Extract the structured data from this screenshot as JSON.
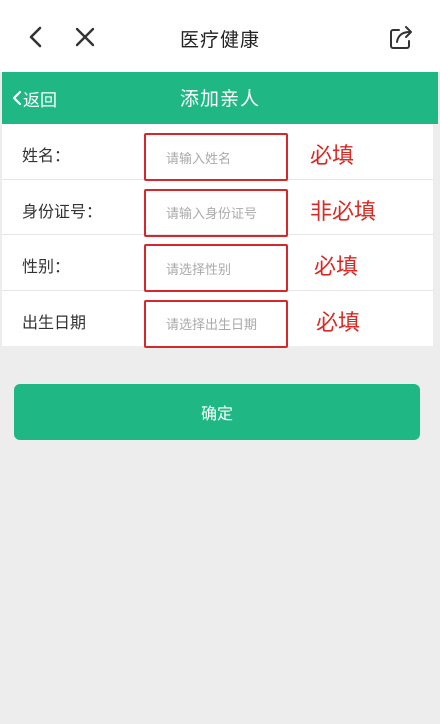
{
  "topbar": {
    "title": "医疗健康"
  },
  "header": {
    "back_label": "返回",
    "title": "添加亲人"
  },
  "form": {
    "rows": [
      {
        "label": "姓名：",
        "placeholder": "请输入姓名",
        "note": "必填"
      },
      {
        "label": "身份证号：",
        "placeholder": "请输入身份证号",
        "note": "非必填"
      },
      {
        "label": "性别：",
        "placeholder": "请选择性别",
        "note": "必填"
      },
      {
        "label": "出生日期",
        "placeholder": "请选择出生日期",
        "note": "必填"
      }
    ]
  },
  "confirm": {
    "label": "确定"
  },
  "colors": {
    "brand_green": "#1fb884",
    "annotation_red": "#d82a24",
    "background": "#ededee"
  }
}
